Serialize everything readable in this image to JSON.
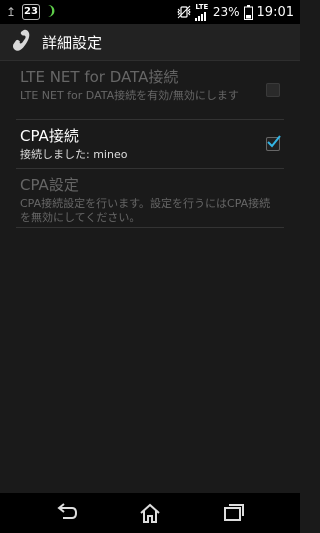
{
  "status_bar": {
    "notification_count": "23",
    "battery_percent": "23%",
    "network_label": "LTE",
    "time": "19:01"
  },
  "action_bar": {
    "title": "詳細設定"
  },
  "settings": [
    {
      "title": "LTE NET for DATA接続",
      "summary": "LTE NET for DATA接続を有効/無効にします",
      "enabled": false,
      "checked": false
    },
    {
      "title": "CPA接続",
      "summary": "接続しました: mineo",
      "enabled": true,
      "checked": true
    },
    {
      "title": "CPA設定",
      "summary": "CPA接続設定を行います。設定を行うにはCPA接続を無効にしてください。",
      "enabled": false,
      "checked": null
    }
  ],
  "colors": {
    "accent": "#33b5e5",
    "background": "#1a1a1a"
  },
  "icons": {
    "app": "phone-handset-icon",
    "back": "back-icon",
    "home": "home-icon",
    "recents": "recents-icon"
  }
}
